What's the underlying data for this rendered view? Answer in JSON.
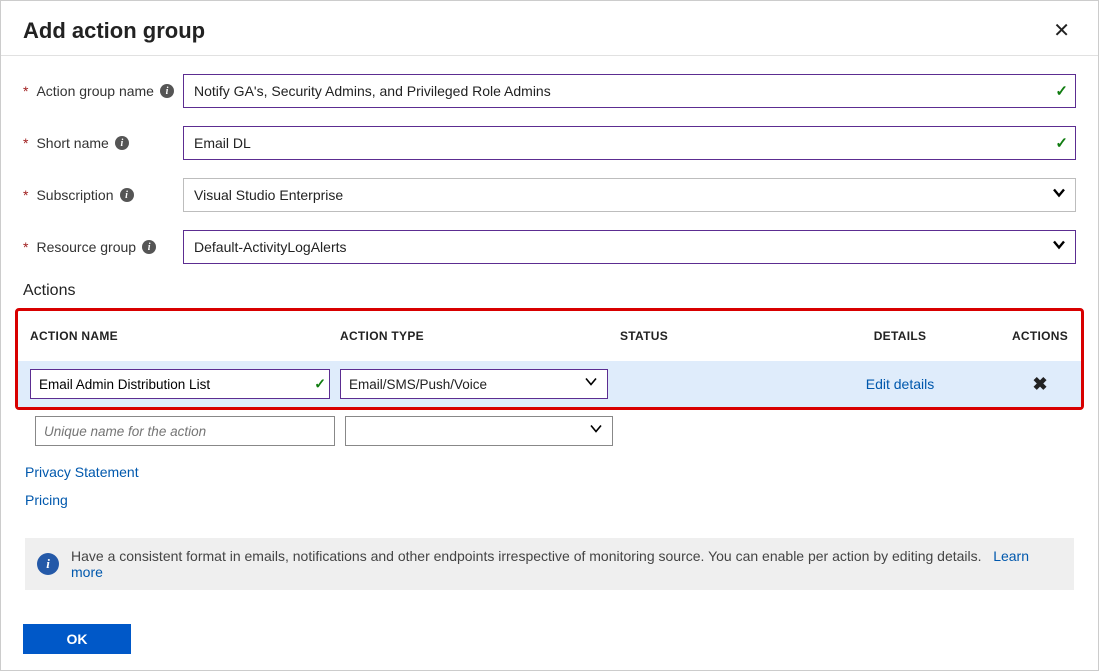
{
  "header": {
    "title": "Add action group"
  },
  "fields": {
    "action_group_name": {
      "label": "Action group name",
      "value": "Notify GA's, Security Admins, and Privileged Role Admins"
    },
    "short_name": {
      "label": "Short name",
      "value": "Email DL"
    },
    "subscription": {
      "label": "Subscription",
      "value": "Visual Studio Enterprise"
    },
    "resource_group": {
      "label": "Resource group",
      "value": "Default-ActivityLogAlerts"
    }
  },
  "actions_section_title": "Actions",
  "actions_table": {
    "headers": {
      "name": "ACTION NAME",
      "type": "ACTION TYPE",
      "status": "STATUS",
      "details": "DETAILS",
      "actions": "ACTIONS"
    },
    "row": {
      "name": "Email Admin Distribution List",
      "type": "Email/SMS/Push/Voice",
      "status": "",
      "details_link": "Edit details"
    },
    "blank_placeholder": "Unique name for the action"
  },
  "links": {
    "privacy": "Privacy Statement",
    "pricing": "Pricing"
  },
  "info_bar": {
    "text": "Have a consistent format in emails, notifications and other endpoints irrespective of monitoring source. You can enable per action by editing details.",
    "learn_more": "Learn more"
  },
  "footer": {
    "ok": "OK"
  }
}
